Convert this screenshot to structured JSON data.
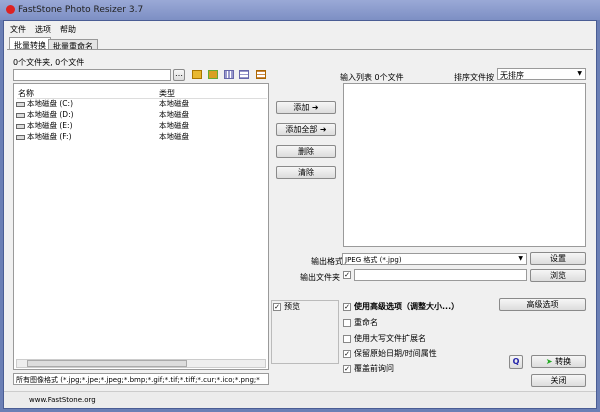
{
  "window": {
    "title": "FastStone Photo Resizer 3.7"
  },
  "menu": [
    "文件",
    "选项",
    "帮助"
  ],
  "tabs": [
    "批量转换",
    "批量重命名"
  ],
  "left": {
    "summary": "0个文件夹, 0个文件",
    "path_value": "",
    "headers": [
      "名称",
      "类型"
    ],
    "rows": [
      {
        "name": "本地磁盘 (C:)",
        "type": "本地磁盘"
      },
      {
        "name": "本地磁盘 (D:)",
        "type": "本地磁盘"
      },
      {
        "name": "本地磁盘 (E:)",
        "type": "本地磁盘"
      },
      {
        "name": "本地磁盘 (F:)",
        "type": "本地磁盘"
      }
    ],
    "filter": "所有图像格式 (*.jpg;*.jpe;*.jpeg;*.bmp;*.gif;*.tif;*.tiff;*.cur;*.ico;*.png;*"
  },
  "middle": {
    "add": "添加 ➜",
    "add_all": "添加全部 ➜",
    "remove": "删除",
    "clear": "清除"
  },
  "right": {
    "input_list": "输入列表  0个文件",
    "sort_label": "排序文件按",
    "sort_value": "无排序"
  },
  "output": {
    "format_label": "输出格式",
    "format_value": "JPEG 格式 (*.jpg)",
    "settings": "设置",
    "folder_label": "输出文件夹",
    "folder_value": "",
    "browse": "浏览"
  },
  "options": {
    "preview": "预览",
    "advanced": "使用高级选项（调整大小...）",
    "rename": "重命名",
    "uppercase": "使用大写文件扩展名",
    "keep_date": "保留原始日期/时间属性",
    "ask_overwrite": "覆盖前询问",
    "advanced_button": "高级选项",
    "convert": "转换",
    "close": "关闭"
  },
  "status": "www.FastStone.org"
}
